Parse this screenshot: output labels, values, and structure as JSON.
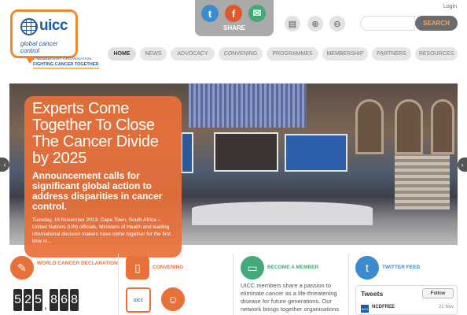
{
  "header": {
    "logo_name": "uicc",
    "logo_sub": "global cancer control",
    "tagline_small": "A MEMBERSHIP ORGANISATION",
    "tagline_big": "FIGHTING CANCER TOGETHER",
    "share_label": "SHARE",
    "search_placeholder": "",
    "search_button": "SEARCH",
    "login": "Login"
  },
  "nav": [
    "HOME",
    "NEWS",
    "ADVOCACY",
    "CONVENING",
    "PROGRAMMES",
    "MEMBERSHIP",
    "PARTNERS",
    "RESOURCES"
  ],
  "hero": {
    "title": "Experts Come Together To Close The Cancer Divide by 2025",
    "subtitle": "Announcement calls for significant global action to address disparities in cancer control.",
    "meta": "Tuesday, 19 November 2013: Cape Town, South Africa – United Nations (UN) officials, Ministers of Health and leading international decision makers have come together for the first time in..."
  },
  "columns": {
    "declaration": {
      "title": "WORLD CANCER DECLARATION",
      "counter": [
        "5",
        "2",
        "5",
        ",",
        "8",
        "6",
        "8"
      ]
    },
    "convening": {
      "title": "CONVENING"
    },
    "member": {
      "title": "BECOME A MEMBER",
      "text": "UICC members share a passion to eliminate cancer as a life-threatening disease for future generations. Our network brings together organisations"
    },
    "twitter": {
      "title": "TWITTER FEED",
      "tweets_label": "Tweets",
      "follow_label": "Follow",
      "tweet_user": "NCDFREE",
      "tweet_date": "22 Nov"
    }
  },
  "colors": {
    "accent": "#e87039",
    "brand": "#1e5aa8",
    "green": "#43a978"
  }
}
